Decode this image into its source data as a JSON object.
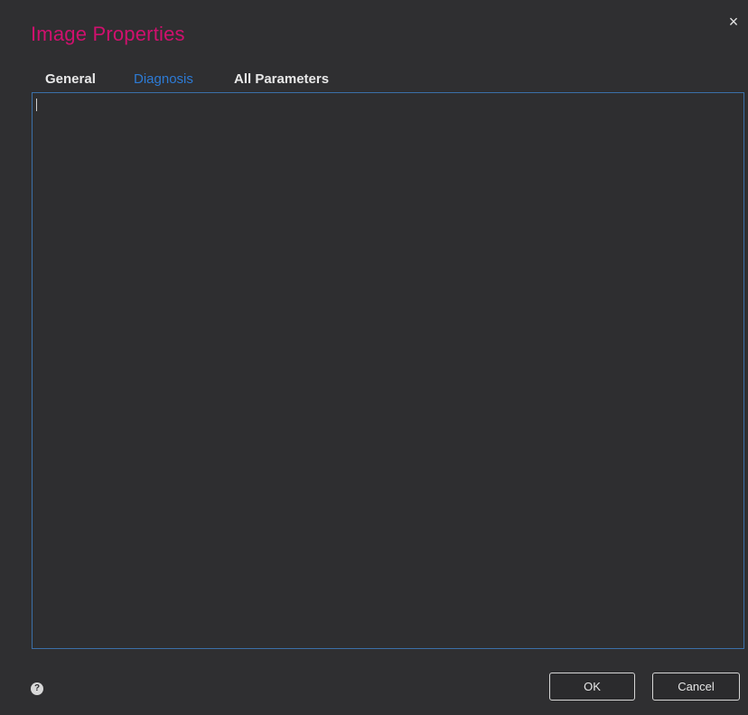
{
  "dialog": {
    "title": "Image Properties",
    "close_glyph": "×",
    "close_icon": "close-icon",
    "title_color": "#d0106e"
  },
  "tabs": [
    {
      "label": "General",
      "active": false
    },
    {
      "label": "Diagnosis",
      "active": true
    },
    {
      "label": "All Parameters",
      "active": false
    }
  ],
  "diagnosis": {
    "value": ""
  },
  "footer": {
    "help_glyph": "?",
    "help_icon": "help-icon",
    "ok_label": "OK",
    "cancel_label": "Cancel"
  },
  "colors": {
    "accent_tab": "#2d7bd6",
    "field_border": "#3b6fa8"
  }
}
